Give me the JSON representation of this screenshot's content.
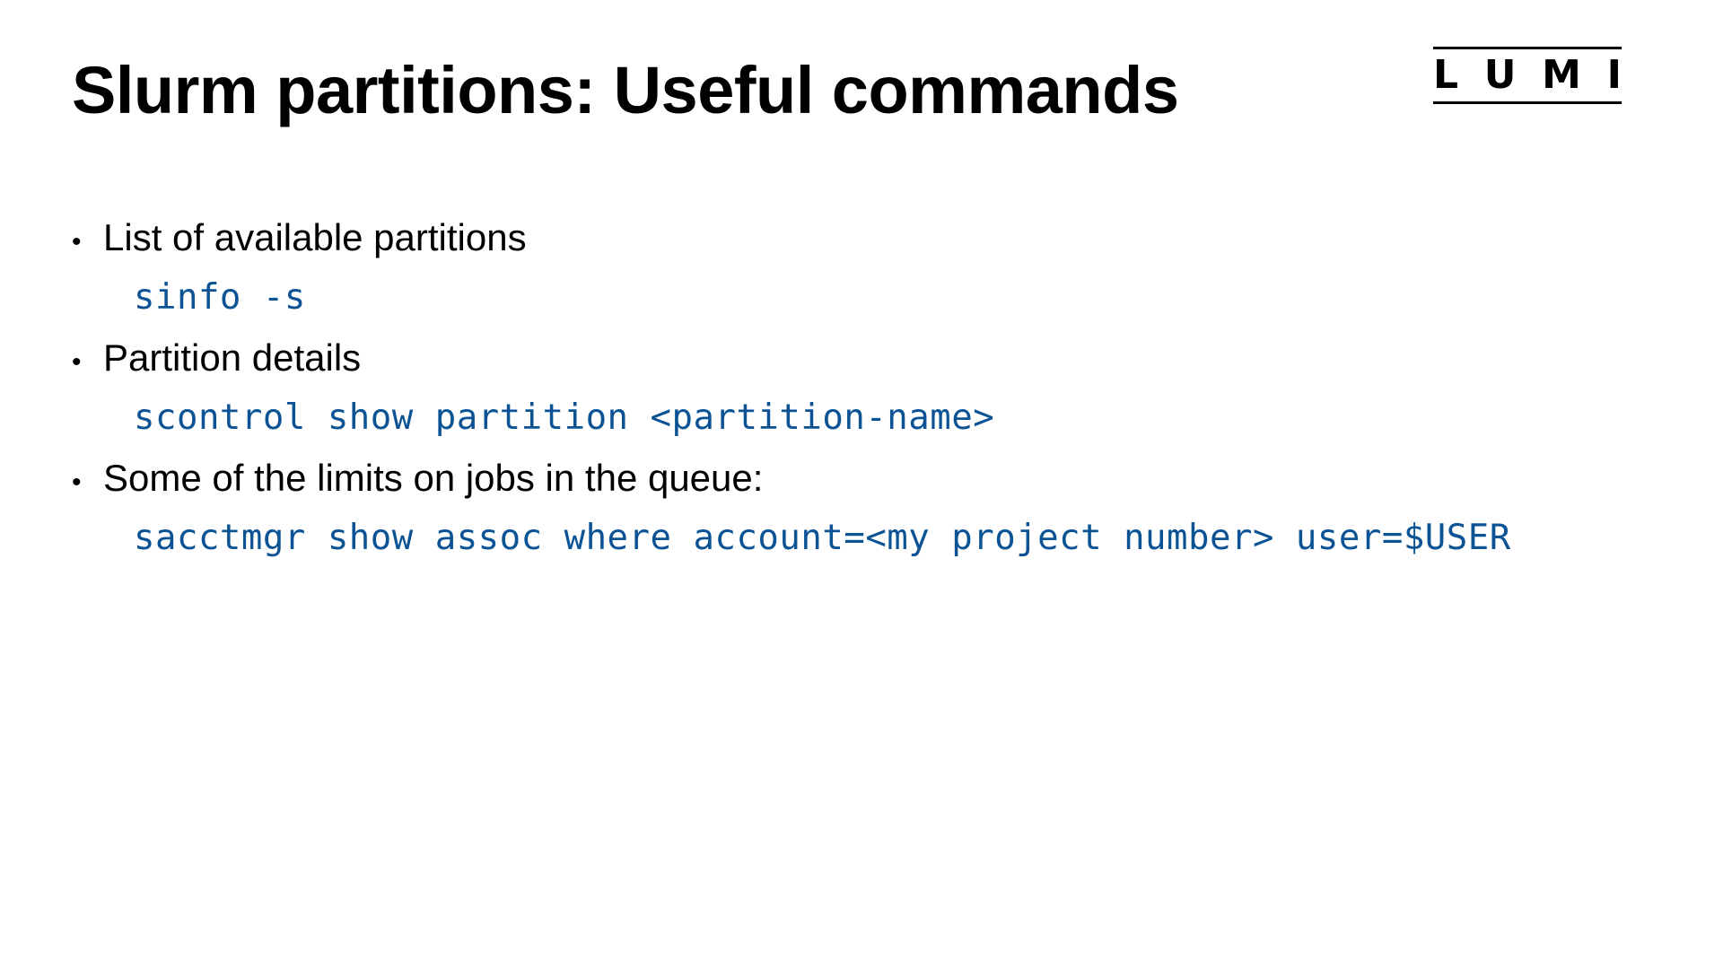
{
  "slide": {
    "title": "Slurm partitions: Useful commands",
    "logo": {
      "letters": [
        "L",
        "U",
        "M",
        "I"
      ]
    },
    "items": [
      {
        "bullet": "List of available partitions",
        "code": "sinfo -s"
      },
      {
        "bullet": "Partition details",
        "code": "scontrol show partition <partition-name>"
      },
      {
        "bullet": "Some of the limits on jobs in the queue:",
        "code": "sacctmgr show assoc where account=<my project number> user=$USER"
      }
    ],
    "colors": {
      "code": "#0b5394",
      "text": "#000000"
    }
  }
}
